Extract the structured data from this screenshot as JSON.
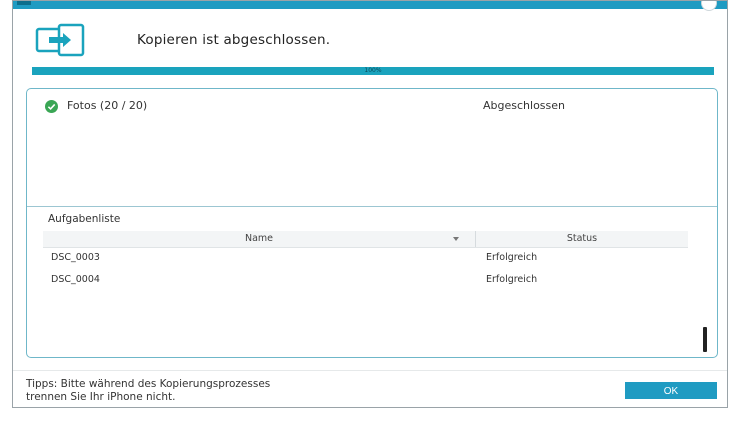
{
  "window": {
    "accent_color": "#1f9bc2"
  },
  "header": {
    "title": "Kopieren ist abgeschlossen.",
    "icon": "device-transfer-icon"
  },
  "progress": {
    "value": 1.0,
    "label": "100%",
    "color": "#1aa3bd"
  },
  "summary": {
    "items": [
      {
        "label": "Fotos (20 / 20)",
        "status": "Abgeschlossen",
        "icon": "check-circle-icon"
      }
    ]
  },
  "tasks": {
    "label": "Aufgabenliste",
    "columns": {
      "name": "Name",
      "status": "Status"
    },
    "rows": [
      {
        "name": "DSC_0003",
        "status": "Erfolgreich"
      },
      {
        "name": "DSC_0004",
        "status": "Erfolgreich"
      }
    ]
  },
  "footer": {
    "tip_line1": "Tipps: Bitte während des Kopierungsprozesses",
    "tip_line2": "trennen Sie Ihr iPhone nicht.",
    "ok_label": "OK"
  }
}
